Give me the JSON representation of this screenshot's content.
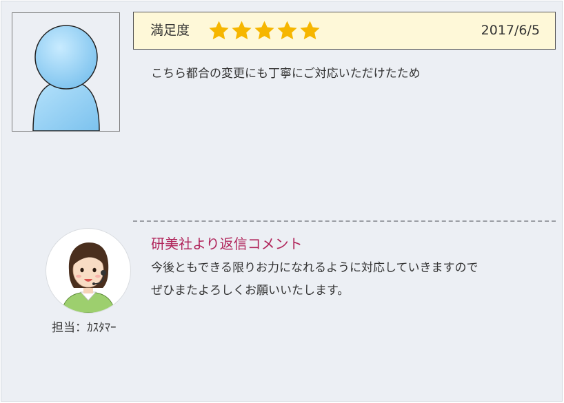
{
  "review": {
    "rating_label": "満足度",
    "rating_value": 5,
    "rating_max": 5,
    "star_icon": "star-icon",
    "date": "2017/6/5",
    "text": "こちら都合の変更にも丁寧にご対応いただけたため",
    "avatar_icon": "user-silhouette-icon"
  },
  "reply": {
    "heading": "研美社より返信コメント",
    "lines": [
      "今後ともできる限りお力になれるように対応していきますので",
      "ぜひまたよろしくお願いいたします。"
    ],
    "staff_label": "担当：ｶｽﾀﾏｰ",
    "staff_icon": "staff-headset-avatar-icon"
  },
  "colors": {
    "background": "#eceff4",
    "rating_bar": "#fef8d8",
    "star": "#f6b600",
    "heading_accent": "#b0245a",
    "avatar_blue": "#8fcdf2"
  }
}
